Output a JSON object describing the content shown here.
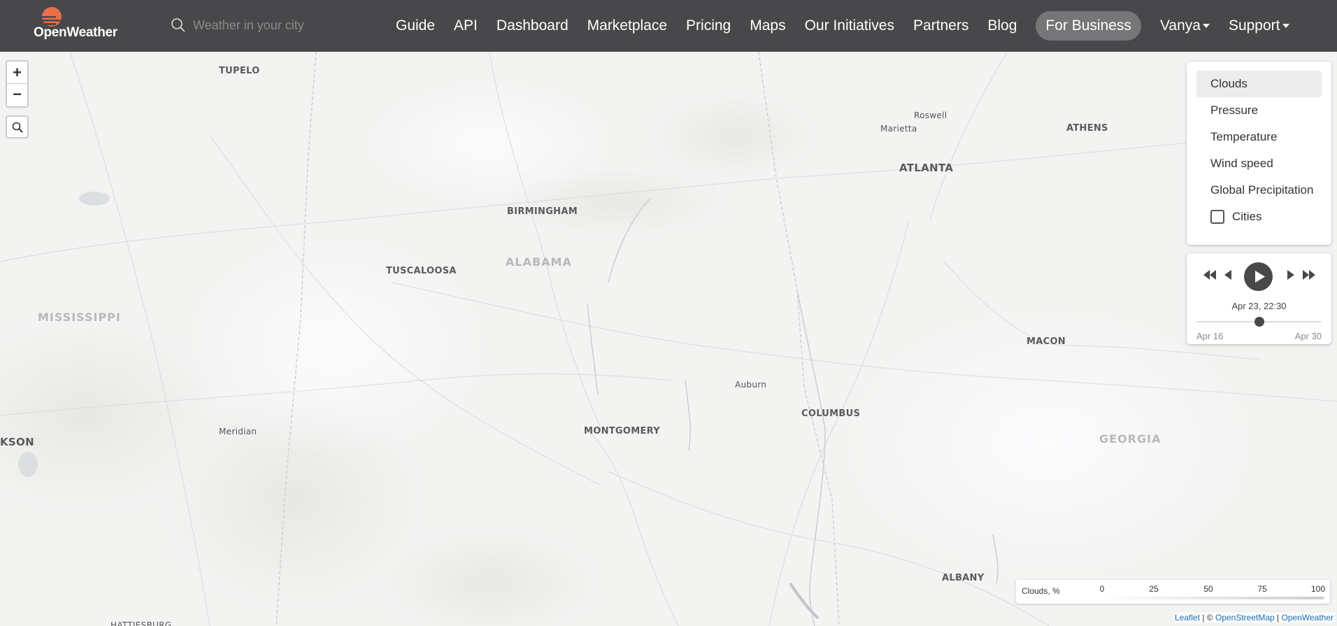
{
  "header": {
    "logo_text": "OpenWeather",
    "search_placeholder": "Weather in your city",
    "nav": [
      {
        "label": "Guide"
      },
      {
        "label": "API"
      },
      {
        "label": "Dashboard"
      },
      {
        "label": "Marketplace"
      },
      {
        "label": "Pricing"
      },
      {
        "label": "Maps"
      },
      {
        "label": "Our Initiatives"
      },
      {
        "label": "Partners"
      },
      {
        "label": "Blog"
      },
      {
        "label": "For Business"
      },
      {
        "label": "Vanya"
      },
      {
        "label": "Support"
      }
    ]
  },
  "map": {
    "zoom_in": "+",
    "zoom_out": "−",
    "labels": {
      "tupelo": "TUPELO",
      "roswell": "Roswell",
      "marietta": "Marietta",
      "athens": "ATHENS",
      "atlanta": "ATLANTA",
      "birmingham": "BIRMINGHAM",
      "alabama": "ALABAMA",
      "tuscaloosa": "TUSCALOOSA",
      "mississippi": "MISSISSIPPI",
      "macon": "MACON",
      "auburn": "Auburn",
      "columbus": "COLUMBUS",
      "kson": "KSON",
      "meridian": "Meridian",
      "montgomery": "MONTGOMERY",
      "georgia": "GEORGIA",
      "albany": "ALBANY",
      "hattiesburg": "HATTIESBURG"
    }
  },
  "layers": {
    "items": [
      {
        "label": "Clouds",
        "active": true
      },
      {
        "label": "Pressure"
      },
      {
        "label": "Temperature"
      },
      {
        "label": "Wind speed"
      },
      {
        "label": "Global Precipitation"
      }
    ],
    "cities_label": "Cities",
    "cities_checked": false
  },
  "player": {
    "time": "Apr 23, 22:30",
    "range_start": "Apr 16",
    "range_end": "Apr 30",
    "position_fraction": 0.5
  },
  "legend": {
    "title": "Clouds, %",
    "ticks": [
      "0",
      "25",
      "50",
      "75",
      "100"
    ]
  },
  "attribution": {
    "leaflet": "Leaflet",
    "sep1": " | © ",
    "osm": "OpenStreetMap",
    "sep2": " | ",
    "ow": "OpenWeather"
  },
  "colors": {
    "header_bg": "#48484a",
    "logo_sun": "#eb6e4b",
    "link": "#1a6fb5"
  }
}
